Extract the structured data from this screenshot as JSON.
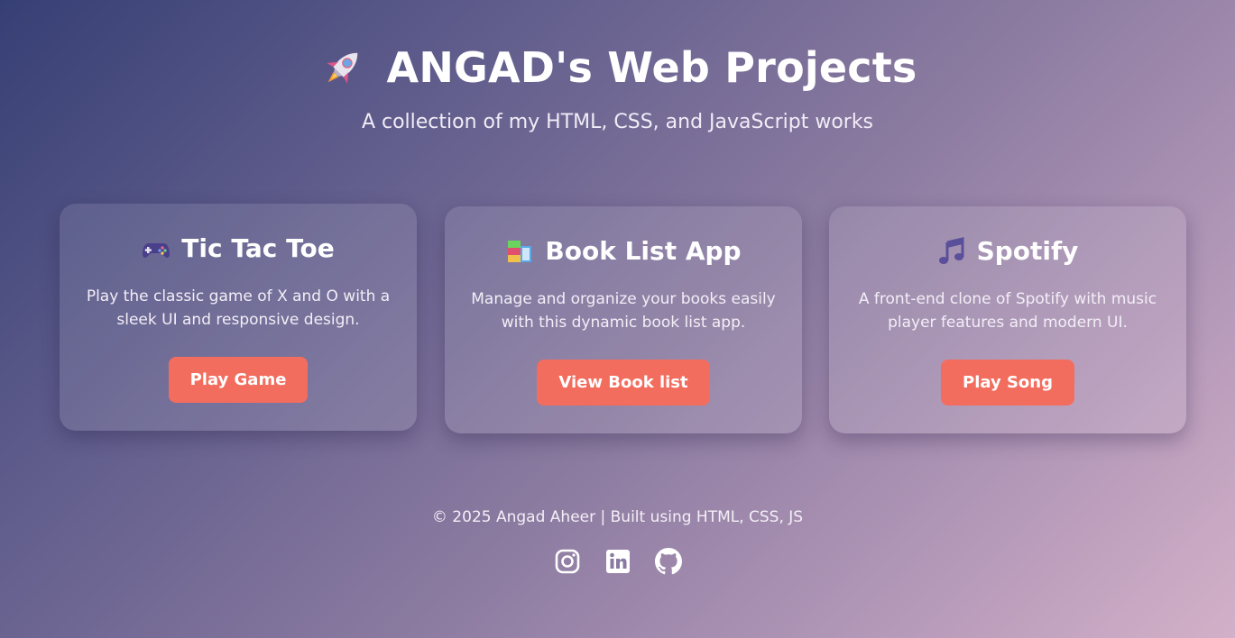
{
  "header": {
    "title": "ANGAD's Web Projects",
    "subtitle": "A collection of my HTML, CSS, and JavaScript works",
    "title_icon": "rocket-icon"
  },
  "projects": [
    {
      "icon": "gamepad-icon",
      "title": "Tic Tac Toe",
      "description": "Play the classic game of X and O with a sleek UI and responsive design.",
      "button_label": "Play Game"
    },
    {
      "icon": "books-icon",
      "title": "Book List App",
      "description": "Manage and organize your books easily with this dynamic book list app.",
      "button_label": "View Book list"
    },
    {
      "icon": "music-note-icon",
      "title": "Spotify",
      "description": "A front-end clone of Spotify with music player features and modern UI.",
      "button_label": "Play Song"
    }
  ],
  "footer": {
    "text": "© 2025 Angad Aheer | Built using HTML, CSS, JS",
    "social": [
      "instagram-icon",
      "linkedin-icon",
      "github-icon"
    ]
  },
  "colors": {
    "button": "#f36d5e",
    "gradient_start": "#363f74",
    "gradient_end": "#d3b0c8"
  }
}
